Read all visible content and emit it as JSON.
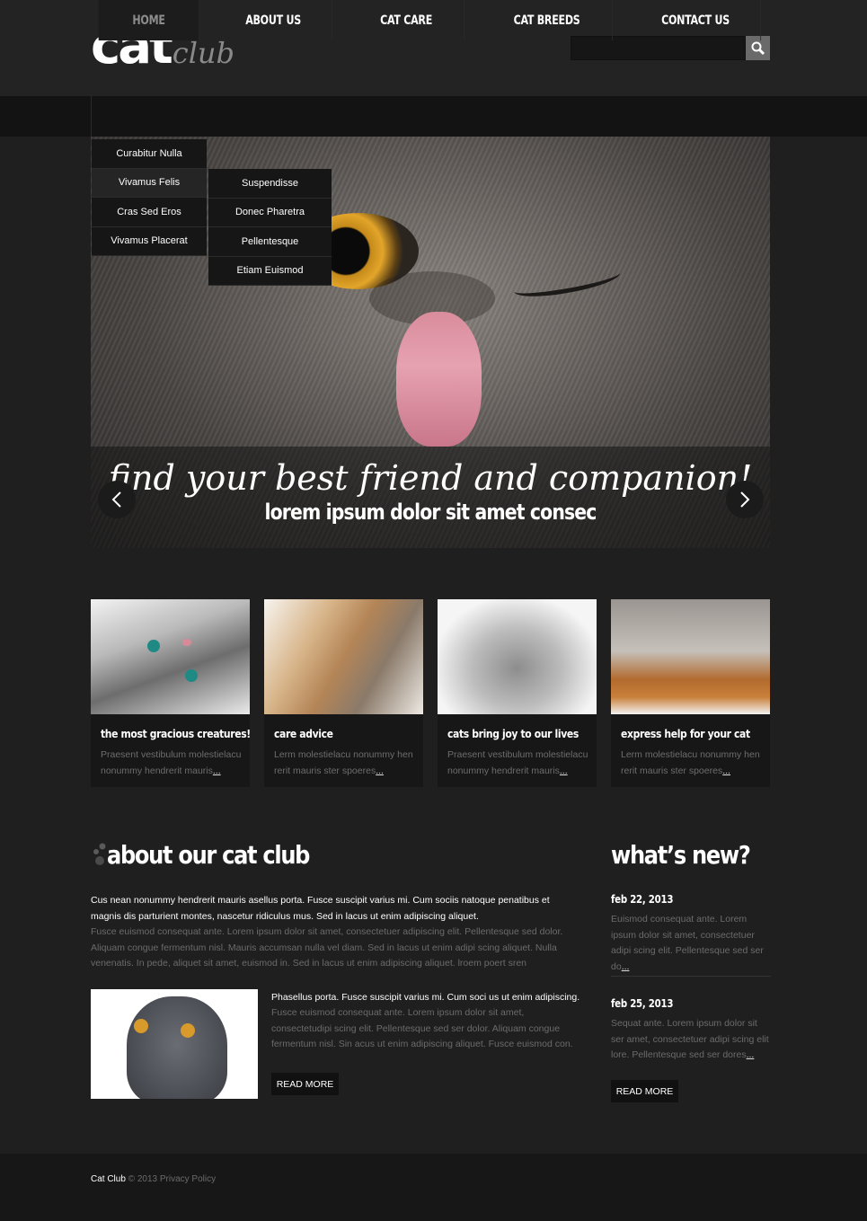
{
  "brand": {
    "logo_main": "cat",
    "logo_sub": "club"
  },
  "search": {
    "placeholder": "",
    "icon": "search-icon"
  },
  "nav": {
    "items": [
      {
        "label": "HOME",
        "active": true
      },
      {
        "label": "ABOUT US"
      },
      {
        "label": "CAT CARE"
      },
      {
        "label": "CAT BREEDS"
      },
      {
        "label": "CONTACT US"
      }
    ]
  },
  "dropdown1": {
    "items": [
      "Curabitur Nulla",
      "Vivamus  Felis",
      "Cras Sed Eros",
      "Vivamus Placerat"
    ]
  },
  "dropdown2": {
    "items": [
      "Suspendisse",
      "Donec Pharetra",
      "Pellentesque",
      "Etiam Euismod"
    ]
  },
  "slider": {
    "caption_script": "find your best friend and companion!",
    "caption_sub": "lorem ipsum dolor sit amet consec",
    "prev_icon": "chevron-left-icon",
    "next_icon": "chevron-right-icon"
  },
  "cards": [
    {
      "title": "the most gracious creatures!",
      "desc": "Praesent vestibulum molestielacu nonummy hendrerit mauris",
      "more": "..."
    },
    {
      "title": "care advice",
      "desc": "Lerm molestielacu nonummy hen rerit mauris ster spoeres",
      "more": "..."
    },
    {
      "title": "cats bring joy to our lives",
      "desc": "Praesent vestibulum molestielacu nonummy hendrerit mauris",
      "more": "..."
    },
    {
      "title": "express help for your cat",
      "desc": "Lerm molestielacu nonummy hen rerit mauris ster spoeres",
      "more": "..."
    }
  ],
  "about": {
    "heading": "about our cat club",
    "lead": "Cus nean nonummy hendrerit mauris asellus porta. Fusce suscipit varius mi. Cum sociis natoque penatibus et magnis dis parturient montes, nascetur ridiculus mus. Sed in lacus ut enim adipiscing aliquet.",
    "body": "Fusce euismod consequat ante. Lorem ipsum dolor sit amet, consectetuer adipiscing elit. Pellentesque sed dolor. Aliquam congue fermentum nisl. Mauris accumsan nulla vel diam. Sed in lacus ut enim adipi scing aliquet. Nulla venenatis. In pede, aliquet sit amet, euismod in. Sed in lacus ut enim adipiscing aliquet. lroem poert sren",
    "lead2": "Phasellus porta. Fusce suscipit varius mi. Cum soci us ut enim adipiscing.",
    "body2": "Fusce euismod consequat ante. Lorem ipsum dolor sit amet, consectetudipi scing elit. Pellentesque sed ser dolor. Aliquam congue fermentum nisl. Sin acus ut enim adipiscing aliquet. Fusce euismod con.",
    "read_more": "READ MORE"
  },
  "news": {
    "heading": "what’s new?",
    "items": [
      {
        "date": "feb 22, 2013",
        "text": "Euismod consequat ante. Lorem ipsum dolor sit amet, consectetuer adipi scing elit. Pellentesque sed ser do",
        "more": "..."
      },
      {
        "date": "feb 25, 2013",
        "text": "Sequat ante. Lorem ipsum dolor sit ser amet, consectetuer adipi scing elit lore. Pellentesque sed ser dores",
        "more": "..."
      }
    ],
    "read_more": "READ MORE"
  },
  "footer": {
    "brand": "Cat Club",
    "rest": " © 2013 Privacy Policy"
  }
}
